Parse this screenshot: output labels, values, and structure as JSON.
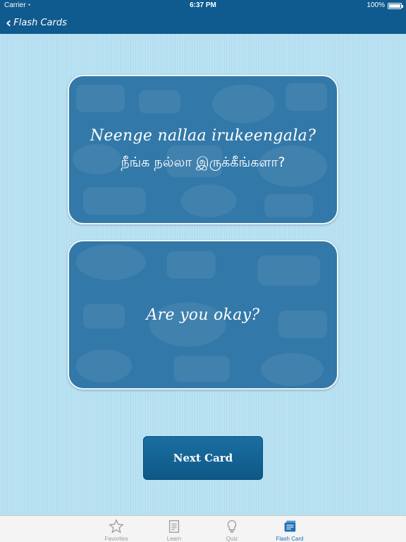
{
  "status_bar": {
    "carrier": "Carrier",
    "time": "6:37 PM",
    "battery": "100%"
  },
  "nav": {
    "back_label": "Flash Cards"
  },
  "cards": {
    "front_phrase": "Neenge nallaa irukeengala?",
    "front_native": "நீங்க நல்லா இருக்கீங்களா?",
    "back_phrase": "Are you okay?"
  },
  "next_button": {
    "label": "Next Card"
  },
  "tab_bar": {
    "items": [
      {
        "label": "Favorites",
        "icon": "star-icon"
      },
      {
        "label": "Learn",
        "icon": "document-icon"
      },
      {
        "label": "Quiz",
        "icon": "lightbulb-icon"
      },
      {
        "label": "Flash Card",
        "icon": "flashcard-icon"
      }
    ],
    "active": "Flash Card"
  },
  "colors": {
    "nav_background": "#0f5a8e",
    "card_background": "#3278a8",
    "content_background": "#b7e2f1",
    "tab_active": "#1d6fb8",
    "tab_inactive": "#9a9a9a"
  }
}
